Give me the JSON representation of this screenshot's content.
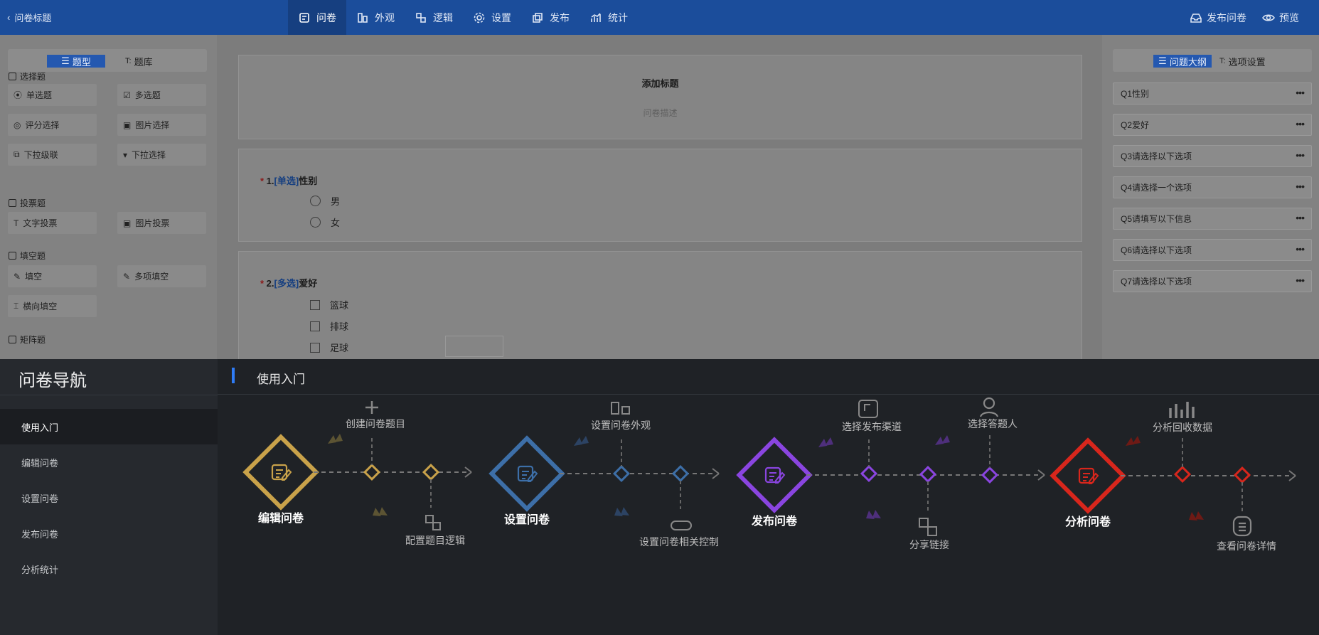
{
  "topbar": {
    "back_label": "问卷标题",
    "tabs": [
      {
        "label": "问卷",
        "icon": "survey-icon"
      },
      {
        "label": "外观",
        "icon": "appearance-icon"
      },
      {
        "label": "逻辑",
        "icon": "logic-icon"
      },
      {
        "label": "设置",
        "icon": "gear-icon"
      },
      {
        "label": "发布",
        "icon": "publish-icon"
      },
      {
        "label": "统计",
        "icon": "chart-icon"
      }
    ],
    "publish_label": "发布问卷",
    "preview_label": "预览"
  },
  "left_panel": {
    "tab_types": "题型",
    "tab_bank": "题库",
    "groups": [
      {
        "title": "选择题",
        "items": [
          "单选题",
          "多选题",
          "评分选择",
          "图片选择",
          "下拉级联",
          "下拉选择"
        ]
      },
      {
        "title": "投票题",
        "items": [
          "文字投票",
          "图片投票"
        ]
      },
      {
        "title": "填空题",
        "items": [
          "填空",
          "多项填空",
          "横向填空"
        ]
      },
      {
        "title": "矩阵题",
        "items": []
      }
    ]
  },
  "survey": {
    "title_placeholder": "添加标题",
    "desc_placeholder": "问卷描述",
    "questions": [
      {
        "number": "1.",
        "type": "[单选]",
        "text": "性别",
        "options": [
          "男",
          "女"
        ]
      },
      {
        "number": "2.",
        "type": "[多选]",
        "text": "爱好",
        "options": [
          "篮球",
          "排球",
          "足球"
        ]
      }
    ]
  },
  "right_panel": {
    "tab_outline": "问题大纲",
    "tab_options": "选项设置",
    "outline": [
      "Q1性别",
      "Q2爱好",
      "Q3请选择以下选项",
      "Q4请选择一个选项",
      "Q5请填写以下信息",
      "Q6请选择以下选项",
      "Q7请选择以下选项"
    ]
  },
  "guide": {
    "title": "问卷导航",
    "nav_items": [
      "使用入门",
      "编辑问卷",
      "设置问卷",
      "发布问卷",
      "分析统计"
    ],
    "header": "使用入门",
    "stages": [
      {
        "label": "编辑问卷",
        "color": "#c9a24a",
        "steps": [
          "创建问卷题目",
          "配置题目逻辑"
        ]
      },
      {
        "label": "设置问卷",
        "color": "#3d6fa8",
        "steps": [
          "设置问卷外观",
          "设置问卷相关控制"
        ]
      },
      {
        "label": "发布问卷",
        "color": "#8a45e0",
        "steps": [
          "选择发布渠道",
          "分享链接",
          "选择答题人"
        ]
      },
      {
        "label": "分析问卷",
        "color": "#d8261c",
        "steps": [
          "分析回收数据",
          "查看问卷详情"
        ]
      }
    ]
  }
}
